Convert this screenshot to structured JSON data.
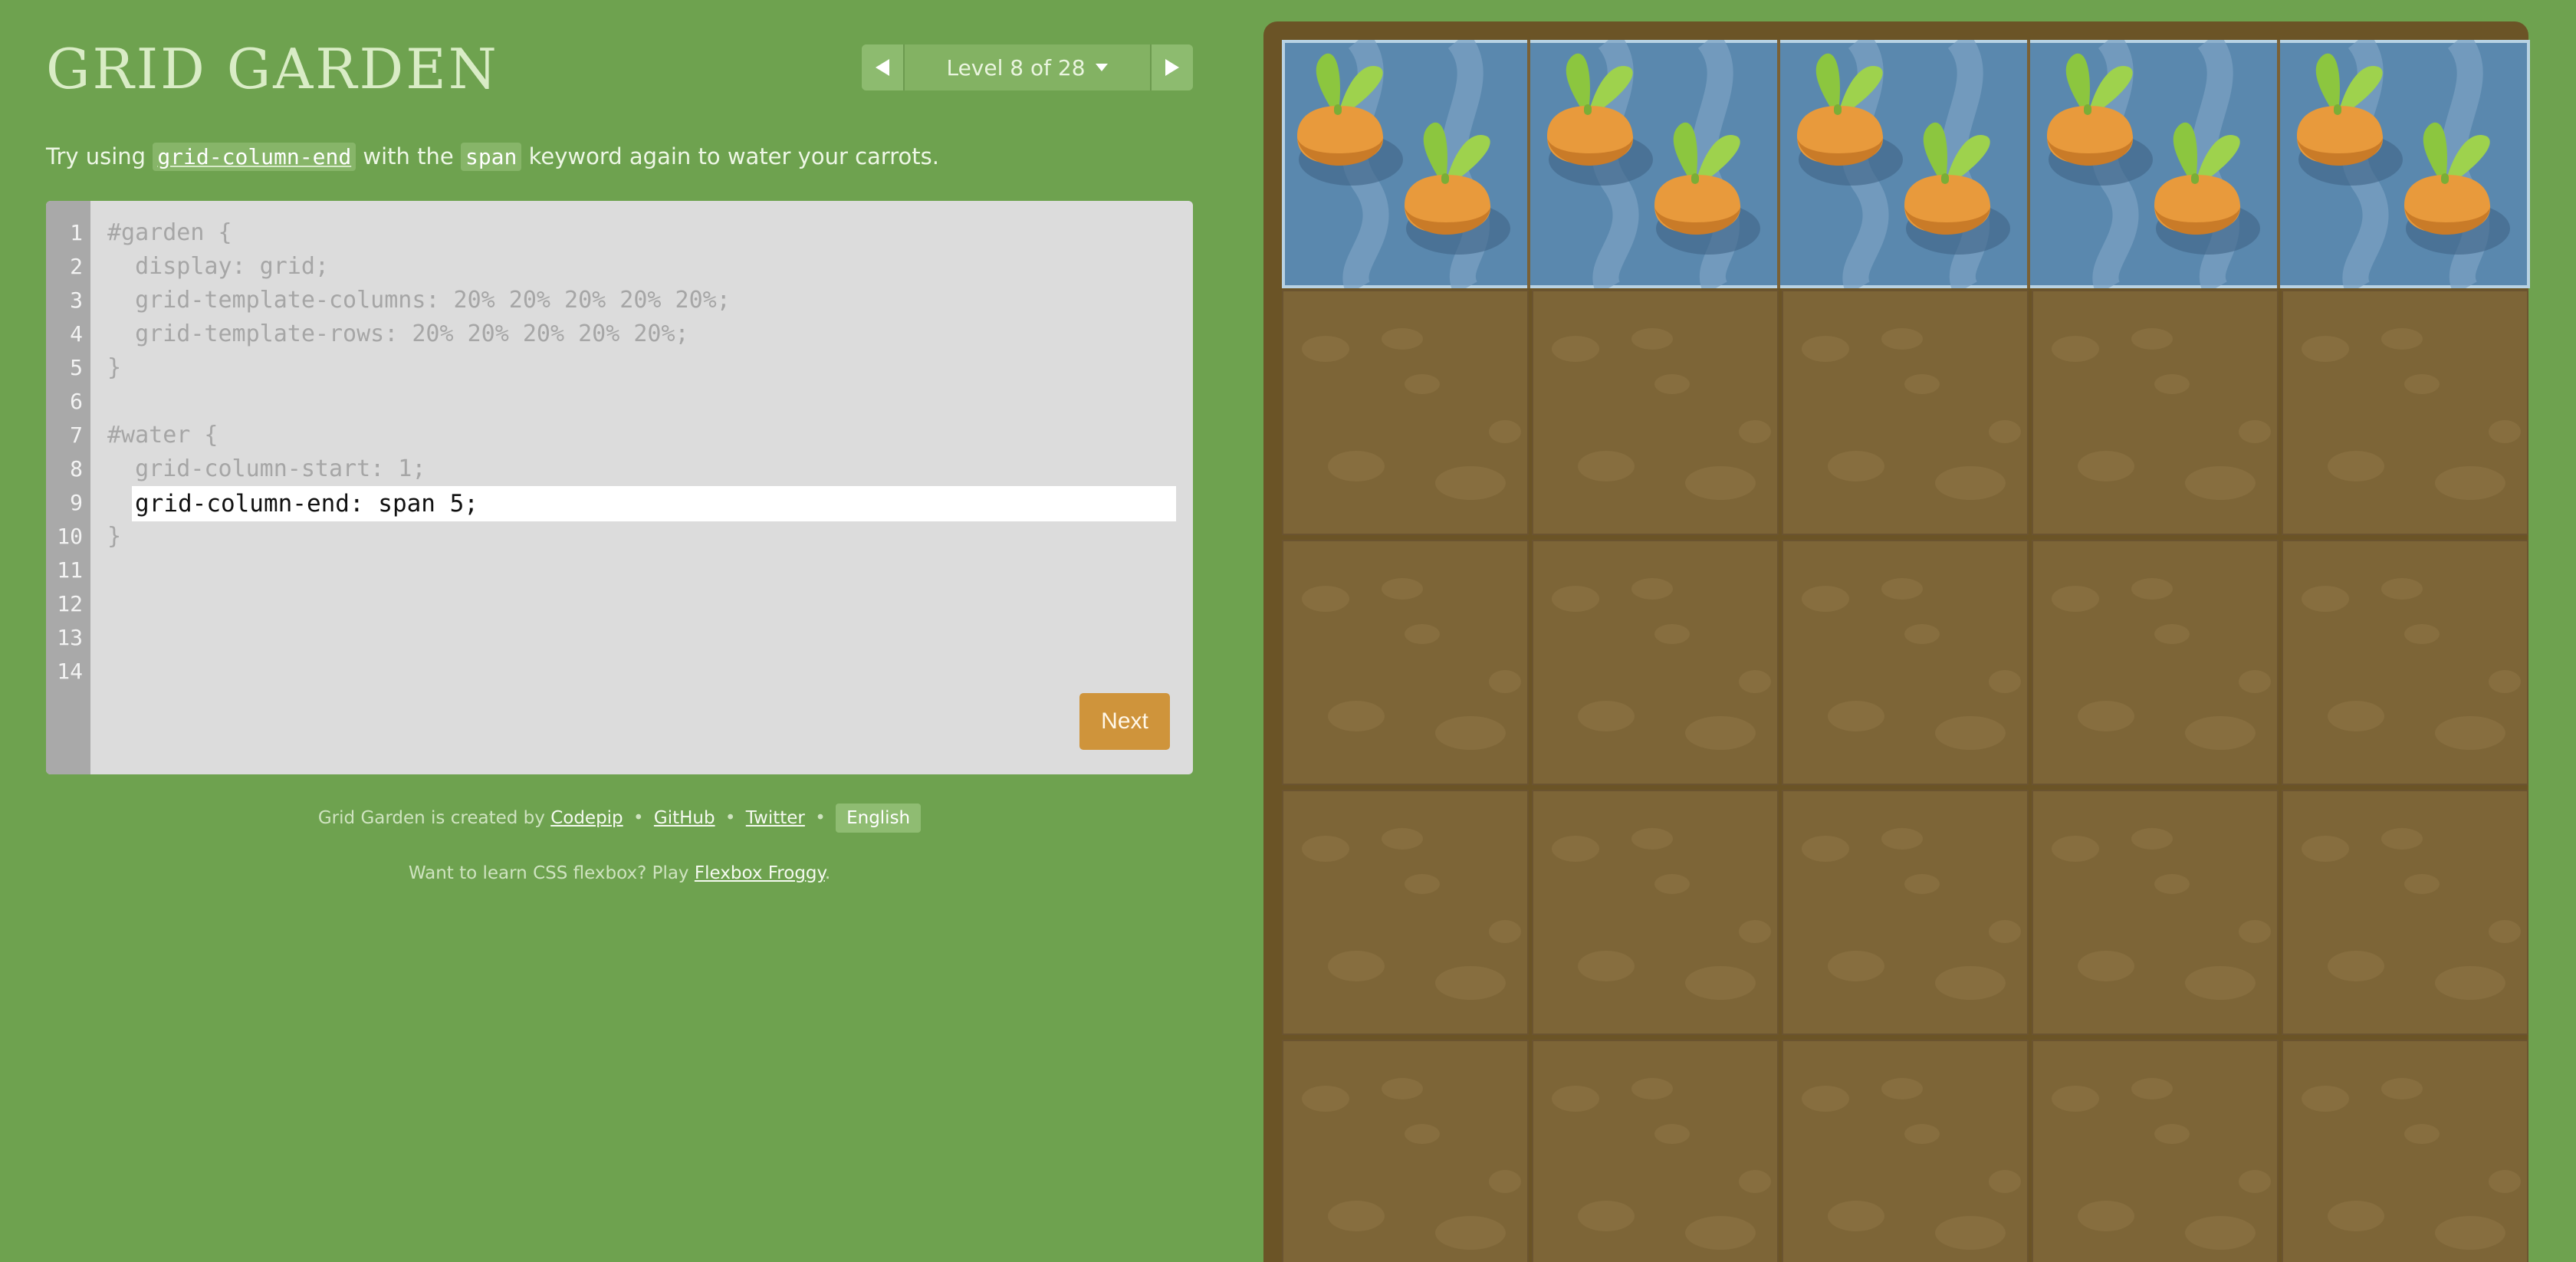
{
  "header": {
    "title": "GRID GARDEN",
    "level_label": "Level 8 of 28"
  },
  "instructions": {
    "prefix": "Try using",
    "code_property": "grid-column-end",
    "middle": "with the",
    "code_keyword": "span",
    "suffix": "keyword again to water your carrots."
  },
  "editor": {
    "line_numbers": [
      "1",
      "2",
      "3",
      "4",
      "5",
      "6",
      "7",
      "8",
      "9",
      "10",
      "11",
      "12",
      "13",
      "14"
    ],
    "lines": [
      "#garden {",
      "  display: grid;",
      "  grid-template-columns: 20% 20% 20% 20% 20%;",
      "  grid-template-rows: 20% 20% 20% 20% 20%;",
      "}",
      "",
      "#water {",
      "  grid-column-start: 1;",
      "",
      "}"
    ],
    "input_value": "grid-column-end: span 5;",
    "next_label": "Next"
  },
  "footer": {
    "created_by": "Grid Garden is created by",
    "codepip": "Codepip",
    "github": "GitHub",
    "twitter": "Twitter",
    "separator": "•",
    "language": "English",
    "flexbox_prefix": "Want to learn CSS flexbox? Play",
    "flexbox_link": "Flexbox Froggy",
    "flexbox_suffix": "."
  },
  "garden": {
    "columns": 5,
    "rows": 5,
    "water": {
      "row": 1,
      "column_start": 1,
      "column_span": 5
    },
    "carrots_per_cell": 2
  },
  "colors": {
    "background": "#6ea24f",
    "soil": "#7d6537",
    "water": "#5a88ae",
    "carrot": "#e89a3c",
    "leaf": "#8cc63f",
    "next_button": "#cf943b"
  },
  "icons": {
    "prev": "triangle-left-icon",
    "next": "triangle-right-icon",
    "dropdown": "caret-down-icon"
  }
}
